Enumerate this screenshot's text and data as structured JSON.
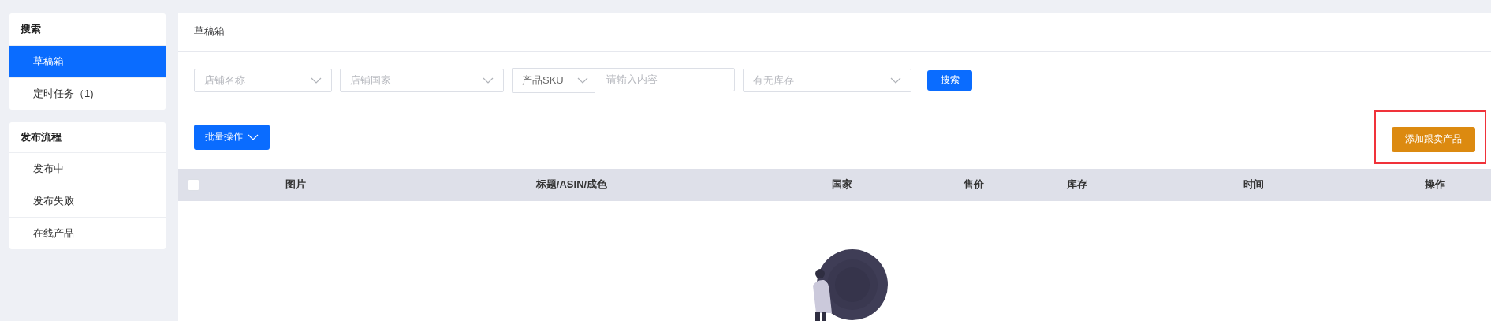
{
  "sidebar": {
    "groups": [
      {
        "title": "搜索",
        "items": [
          {
            "label": "草稿箱",
            "selected": true
          },
          {
            "label": "定时任务（1)",
            "selected": false
          }
        ]
      },
      {
        "title": "发布流程",
        "items": [
          {
            "label": "发布中",
            "selected": false
          },
          {
            "label": "发布失败",
            "selected": false
          },
          {
            "label": "在线产品",
            "selected": false
          }
        ]
      }
    ]
  },
  "main": {
    "title": "草稿箱",
    "filters": [
      {
        "kind": "select",
        "placeholder": "店铺名称"
      },
      {
        "kind": "select",
        "placeholder": "店铺国家"
      },
      {
        "kind": "combo",
        "prefix": "产品SKU",
        "placeholder": "请输入内容"
      },
      {
        "kind": "select",
        "placeholder": "有无库存"
      }
    ],
    "search_button": "搜索",
    "batch_button": "批量操作",
    "add_button": {
      "label": "添加跟卖产品",
      "highlighted": true
    },
    "table": {
      "select_all": {
        "checked": false
      },
      "columns": [
        "图片",
        "标题/ASIN/成色",
        "国家",
        "售价",
        "库存",
        "时间",
        "操作"
      ]
    }
  }
}
